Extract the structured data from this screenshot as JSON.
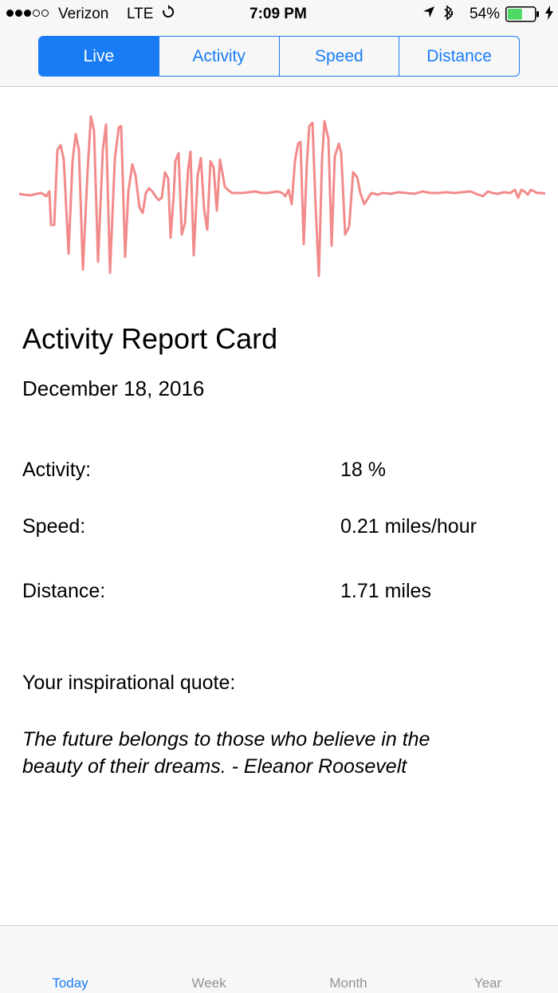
{
  "status": {
    "carrier": "Verizon",
    "network": "LTE",
    "time": "7:09 PM",
    "battery_pct": "54%",
    "battery_level": 0.54,
    "signal_bars": 3,
    "signal_total": 5,
    "icons": [
      "sync-icon",
      "location-arrow-icon",
      "bluetooth-icon",
      "battery-icon",
      "charging-bolt-icon"
    ]
  },
  "segments": {
    "items": [
      "Live",
      "Activity",
      "Speed",
      "Distance"
    ],
    "selected": "Live"
  },
  "colors": {
    "accent": "#1a7cf5",
    "wave": "#f28a8a",
    "inactive_tab": "#929292",
    "battery": "#4cd964"
  },
  "report": {
    "title": "Activity Report Card",
    "date": "December 18, 2016",
    "activity_label": "Activity:",
    "activity_value": "18 %",
    "speed_label": "Speed:",
    "speed_value": "0.21 miles/hour",
    "distance_label": "Distance:",
    "distance_value": "1.71 miles",
    "quote_label": "Your inspirational quote:",
    "quote": "The future belongs to those who believe in the beauty of their dreams. - Eleanor Roosevelt"
  },
  "tabs": [
    "Today",
    "Week",
    "Month",
    "Year"
  ],
  "active_tab": "Today"
}
